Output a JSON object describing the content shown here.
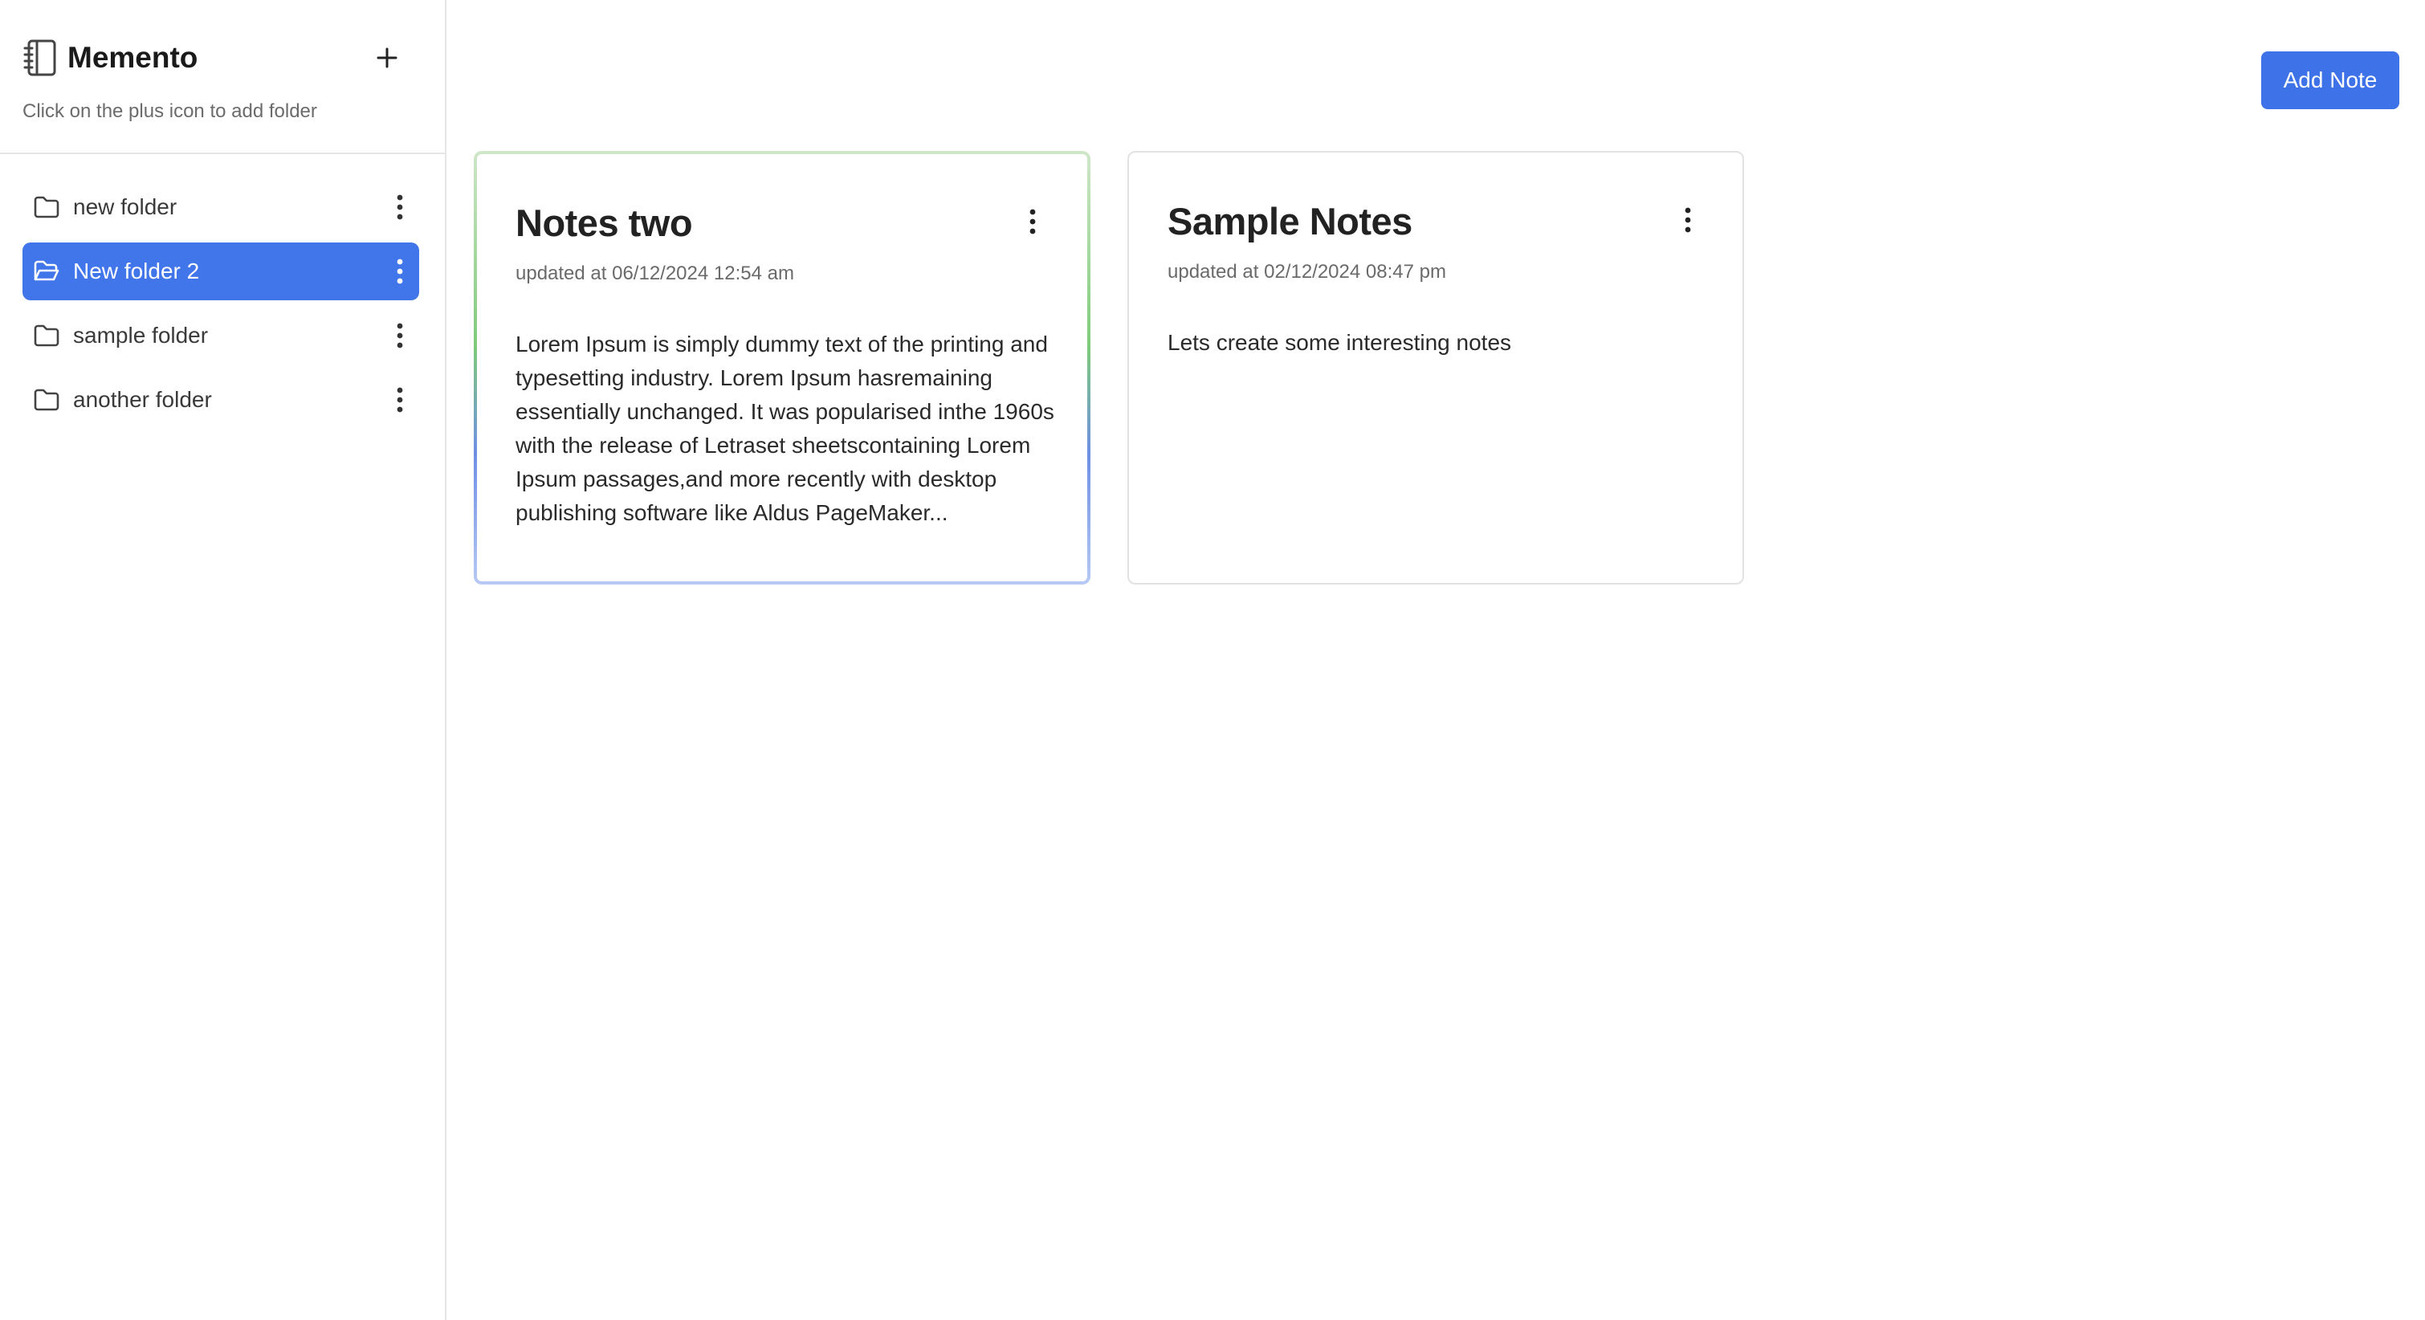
{
  "sidebar": {
    "brand": "Memento",
    "hint": "Click on the plus icon to add folder",
    "add_icon": "plus-icon",
    "folders": [
      {
        "label": "new folder",
        "active": false
      },
      {
        "label": "New folder 2",
        "active": true
      },
      {
        "label": "sample folder",
        "active": false
      },
      {
        "label": "another folder",
        "active": false
      }
    ]
  },
  "toolbar": {
    "add_note_label": "Add Note"
  },
  "notes": [
    {
      "title": "Notes two",
      "updated": "updated at 06/12/2024 12:54 am",
      "body": "Lorem Ipsum is simply dummy text of the printing and typesetting industry. Lorem Ipsum hasremaining essentially unchanged. It was popularised inthe 1960s with the release of Letraset sheetscontaining Lorem Ipsum passages,and more recently with desktop publishing software like Aldus PageMaker..."
    },
    {
      "title": "Sample Notes",
      "updated": "updated at 02/12/2024 08:47 pm",
      "body": "Lets create some interesting notes"
    }
  ],
  "colors": {
    "accent": "#3e72e8",
    "active_folder": "#4175ea",
    "border": "#e6e6e6"
  }
}
